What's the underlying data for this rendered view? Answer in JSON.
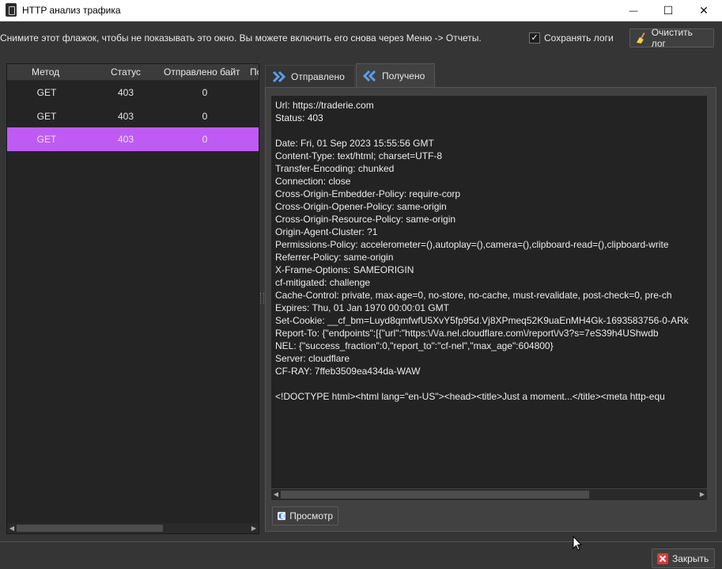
{
  "window": {
    "title": "HTTP анализ трафика"
  },
  "controls": {
    "minimize": "—",
    "maximize": "☐",
    "close": "✕"
  },
  "info_text": "Снимите этот флажок, чтобы не показывать это окно. Вы можете включить его снова через Меню -> Отчеты.",
  "save_logs": {
    "label": "Сохранять логи",
    "checked": "✓"
  },
  "clear_log_button": "Очистить лог",
  "table": {
    "headers": [
      "Метод",
      "Статус",
      "Отправлено байт",
      "По"
    ],
    "rows": [
      {
        "method": "GET",
        "status": "403",
        "sent": "0"
      },
      {
        "method": "GET",
        "status": "403",
        "sent": "0"
      },
      {
        "method": "GET",
        "status": "403",
        "sent": "0"
      }
    ]
  },
  "tabs": {
    "sent": "Отправлено",
    "received": "Получено"
  },
  "response_lines": [
    "Url: https://traderie.com",
    "Status: 403",
    "",
    "Date: Fri, 01 Sep 2023 15:55:56 GMT",
    "Content-Type: text/html; charset=UTF-8",
    "Transfer-Encoding: chunked",
    "Connection: close",
    "Cross-Origin-Embedder-Policy: require-corp",
    "Cross-Origin-Opener-Policy: same-origin",
    "Cross-Origin-Resource-Policy: same-origin",
    "Origin-Agent-Cluster: ?1",
    "Permissions-Policy: accelerometer=(),autoplay=(),camera=(),clipboard-read=(),clipboard-write",
    "Referrer-Policy: same-origin",
    "X-Frame-Options: SAMEORIGIN",
    "cf-mitigated: challenge",
    "Cache-Control: private, max-age=0, no-store, no-cache, must-revalidate, post-check=0, pre-ch",
    "Expires: Thu, 01 Jan 1970 00:00:01 GMT",
    "Set-Cookie: __cf_bm=Luyd8qmfwfU5XvY5fp95d.Vj8XPmeq52K9uaEnMH4Gk-1693583756-0-ARk",
    "Report-To: {\"endpoints\":[{\"url\":\"https:\\/\\/a.nel.cloudflare.com\\/report\\/v3?s=7eS39h4UShwdb",
    "NEL: {\"success_fraction\":0,\"report_to\":\"cf-nel\",\"max_age\":604800}",
    "Server: cloudflare",
    "CF-RAY: 7ffeb3509ea434da-WAW",
    "",
    "<!DOCTYPE html><html lang=\"en-US\"><head><title>Just a moment...</title><meta http-equ"
  ],
  "preview_button": "Просмотр",
  "close_button": "Закрыть",
  "colors": {
    "selected_row": "#bf5af5",
    "tab_icon": "#5a9fe8",
    "close_icon": "#d93a3a"
  }
}
